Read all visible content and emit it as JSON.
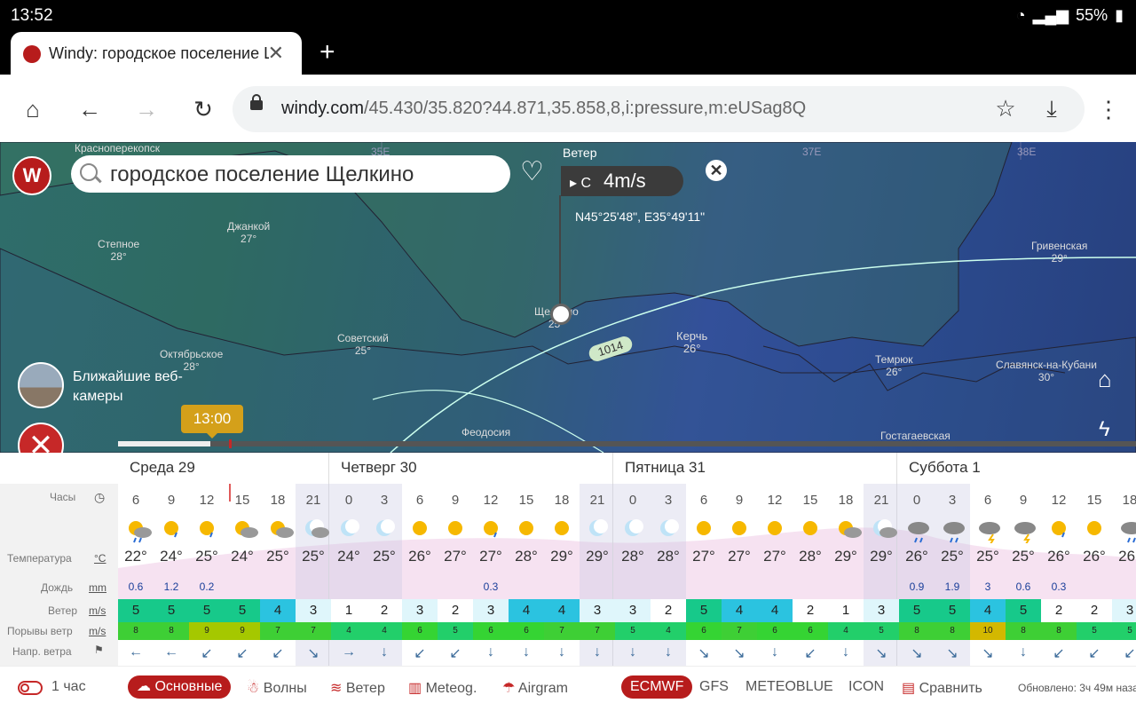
{
  "statusbar": {
    "time": "13:52",
    "battery": "55%"
  },
  "browser": {
    "tab_title": "Windy: городское поселение Щелкино",
    "url_host": "windy.com",
    "url_path": "/45.430/35.820?44.871,35.858,8,i:pressure,m:eUSag8Q"
  },
  "map": {
    "search_value": "городское поселение Щелкино",
    "wind_label": "Ветер",
    "wind_dir": "С",
    "wind_value": "4m/s",
    "coords": "N45°25'48\", E35°49'11\"",
    "webcams_label": "Ближайшие веб-камеры",
    "time_label": "13:00",
    "isobar_label": "1014",
    "places": [
      {
        "name": "Красноперекопск"
      },
      {
        "name": "Степное",
        "temp": "28°"
      },
      {
        "name": "Джанкой",
        "temp": "27°"
      },
      {
        "name": "Октябрьское",
        "temp": "28°"
      },
      {
        "name": "Советский",
        "temp": "25°"
      },
      {
        "name": "Щелкино",
        "temp": "25°"
      },
      {
        "name": "Керчь",
        "temp": "26°"
      },
      {
        "name": "Гривенская",
        "temp": "29°"
      },
      {
        "name": "Темрюк",
        "temp": "26°"
      },
      {
        "name": "Славянск-на-Кубани",
        "temp": "30°"
      },
      {
        "name": "Феодосия"
      },
      {
        "name": "Гостагаевская"
      }
    ],
    "meridians": [
      "35E",
      "37E",
      "38E"
    ]
  },
  "forecast": {
    "row_labels": {
      "hours": "Часы",
      "temperature": "Температура",
      "temperature_unit": "°C",
      "rain": "Дождь",
      "rain_unit": "mm",
      "wind": "Ветер",
      "wind_unit": "m/s",
      "gusts": "Порывы ветр",
      "gusts_unit": "m/s",
      "wind_dir": "Напр. ветра"
    },
    "days": [
      "Среда 29",
      "Четверг 30",
      "Пятница 31",
      "Суббота 1"
    ],
    "hours": [
      "6",
      "9",
      "12",
      "15",
      "18",
      "21",
      "0",
      "3",
      "6",
      "9",
      "12",
      "15",
      "18",
      "21",
      "0",
      "3",
      "6",
      "9",
      "12",
      "15",
      "18",
      "21",
      "0",
      "3",
      "6",
      "9",
      "12",
      "15",
      "18"
    ],
    "icons": [
      "rain-sun",
      "sun-rain",
      "sun-rain",
      "sun-cloud",
      "sun-cloud",
      "moon-cloud",
      "moon",
      "moon",
      "sun",
      "sun",
      "sun-rain",
      "sun",
      "sun",
      "moon",
      "moon",
      "moon",
      "sun",
      "sun",
      "sun",
      "sun",
      "sun-cloud",
      "moon-cloud",
      "rain-cloud",
      "rain-cloud",
      "storm",
      "storm",
      "sun-rain",
      "sun",
      "rain-cloud"
    ],
    "temps": [
      "22°",
      "24°",
      "25°",
      "24°",
      "25°",
      "25°",
      "24°",
      "25°",
      "26°",
      "27°",
      "27°",
      "28°",
      "29°",
      "29°",
      "28°",
      "28°",
      "27°",
      "27°",
      "27°",
      "28°",
      "29°",
      "29°",
      "26°",
      "25°",
      "25°",
      "25°",
      "26°",
      "26°",
      "26°"
    ],
    "rain": [
      "0.6",
      "1.2",
      "0.2",
      "",
      "",
      "",
      "",
      "",
      "",
      "",
      "0.3",
      "",
      "",
      "",
      "",
      "",
      "",
      "",
      "",
      "",
      "",
      "",
      "0.9",
      "1.9",
      "3",
      "0.6",
      "0.3",
      "",
      ""
    ],
    "wind": [
      "5",
      "5",
      "5",
      "5",
      "4",
      "3",
      "1",
      "2",
      "3",
      "2",
      "3",
      "4",
      "4",
      "3",
      "3",
      "2",
      "5",
      "4",
      "4",
      "2",
      "1",
      "3",
      "5",
      "5",
      "4",
      "5",
      "2",
      "2",
      "3"
    ],
    "gusts": [
      "8",
      "8",
      "9",
      "9",
      "7",
      "7",
      "4",
      "4",
      "6",
      "5",
      "6",
      "6",
      "7",
      "7",
      "5",
      "4",
      "6",
      "7",
      "6",
      "6",
      "4",
      "5",
      "8",
      "8",
      "10",
      "8",
      "8",
      "5",
      "5"
    ],
    "directions": [
      "←",
      "←",
      "↙",
      "↙",
      "↙",
      "↘",
      "→",
      "↓",
      "↙",
      "↙",
      "↓",
      "↓",
      "↓",
      "↓",
      "↓",
      "↓",
      "↘",
      "↘",
      "↓",
      "↙",
      "↓",
      "↘",
      "↘",
      "↘",
      "↘",
      "↓",
      "↙",
      "↙",
      "↙"
    ]
  },
  "bottombar": {
    "interval": "1 час",
    "basic": "Основные",
    "waves": "Волны",
    "wind": "Ветер",
    "meteog": "Meteog.",
    "airgram": "Airgram",
    "ecmwf": "ECMWF",
    "gfs": "GFS",
    "meteoblue": "METEOBLUE",
    "icon": "ICON",
    "compare": "Сравнить",
    "updated": "Обновлено: 3ч 49м назад"
  },
  "colors": {
    "accent": "#b71c1c",
    "time_bubble": "#d4a01a"
  }
}
